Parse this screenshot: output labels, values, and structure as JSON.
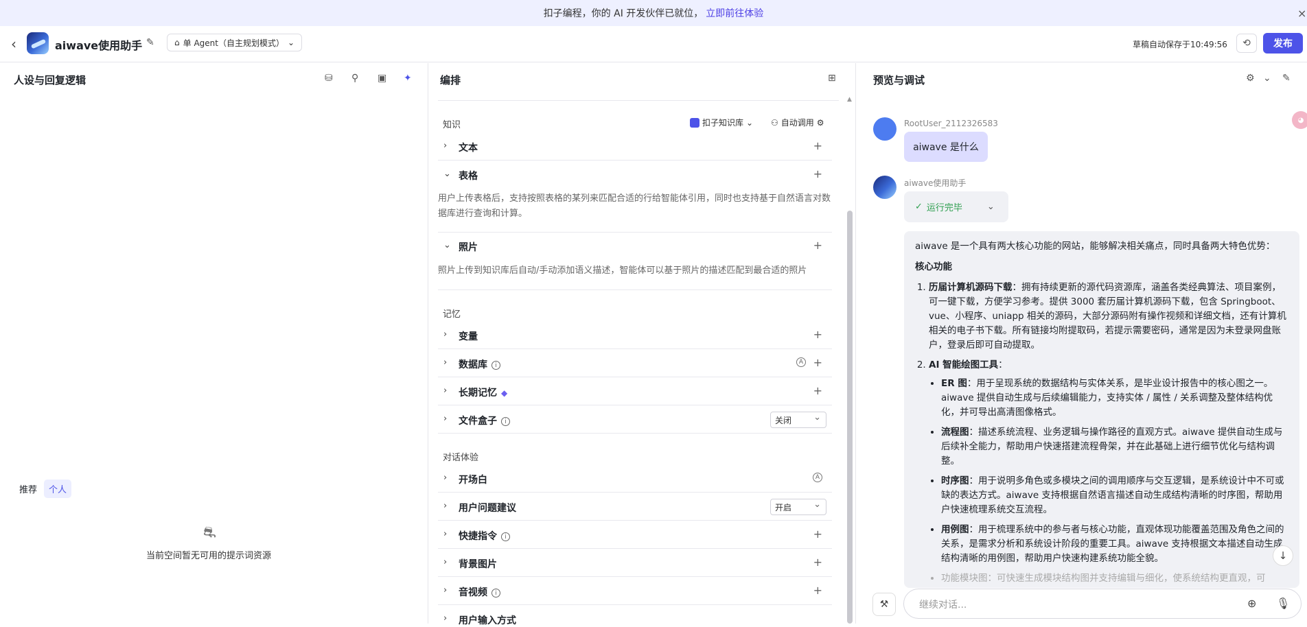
{
  "banner": {
    "text": "扣子编程，你的 AI 开发伙伴已就位，",
    "link": "立即前往体验",
    "close": "×"
  },
  "topbar": {
    "back": "‹",
    "app_name": "aiwave使用助手",
    "edit": "✎",
    "agent_mode": "单 Agent（自主规划模式）",
    "agent_icon": "⌂",
    "chevron": "⌄",
    "saved": "草稿自动保存于10:49:56",
    "history_icon": "⟲",
    "publish": "发布"
  },
  "left": {
    "title": "人设与回复逻辑",
    "icons": [
      "⛁",
      "⚲",
      "▣",
      "✦"
    ],
    "tabs": [
      "推荐",
      "个人"
    ],
    "empty_icon": "⛐",
    "empty_text": "当前空间暂无可用的提示词资源"
  },
  "mid": {
    "title": "编排",
    "grid_icon": "⊞",
    "knowledge": {
      "label": "知识",
      "kb_btn": "扣子知识库",
      "auto_btn": "自动调用"
    },
    "rows": [
      {
        "label": "文本",
        "chev": "›"
      },
      {
        "label": "表格",
        "chev": "⌄"
      },
      {
        "label": "照片",
        "chev": "⌄"
      }
    ],
    "table_desc": "用户上传表格后，支持按照表格的某列来匹配合适的行给智能体引用，同时也支持基于自然语言对数据库进行查询和计算。",
    "photo_desc": "照片上传到知识库后自动/手动添加语义描述，智能体可以基于照片的描述匹配到最合适的照片",
    "memory": {
      "label": "记忆",
      "rows": [
        "变量",
        "数据库",
        "长期记忆",
        "文件盒子"
      ],
      "file_box_value": "关闭"
    },
    "dialog": {
      "label": "对话体验",
      "rows": [
        "开场白",
        "用户问题建议",
        "快捷指令",
        "背景图片",
        "音视频",
        "用户输入方式"
      ],
      "suggest_value": "开启"
    },
    "plus": "+",
    "info": "i",
    "auto": "A"
  },
  "right": {
    "title": "预览与调试",
    "user": {
      "name": "RootUser_2112326583",
      "message": "aiwave 是什么"
    },
    "bot": {
      "name": "aiwave使用助手",
      "status": "运行完毕",
      "intro": "aiwave 是一个具有两大核心功能的网站，能够解决相关痛点，同时具备两大特色优势：",
      "core_title": "核心功能",
      "item1_title": "历届计算机源码下载",
      "item1_text": "：拥有持续更新的源代码资源库，涵盖各类经典算法、项目案例，可一键下载，方便学习参考。提供 3000 套历届计算机源码下载，包含 Springboot、vue、小程序、uniapp 相关的源码，大部分源码附有操作视频和详细文档，还有计算机相关的电子书下载。所有链接均附提取码，若提示需要密码，通常是因为未登录网盘账户，登录后即可自动提取。",
      "item2_title": "AI 智能绘图工具",
      "item2_suffix": "：",
      "subs": [
        {
          "t": "ER 图",
          "d": "：用于呈现系统的数据结构与实体关系，是毕业设计报告中的核心图之一。aiwave 提供自动生成与后续编辑能力，支持实体 / 属性 / 关系调整及整体结构优化，并可导出高清图像格式。"
        },
        {
          "t": "流程图",
          "d": "：描述系统流程、业务逻辑与操作路径的直观方式。aiwave 提供自动生成与后续补全能力，帮助用户快速搭建流程骨架，并在此基础上进行细节优化与结构调整。"
        },
        {
          "t": "时序图",
          "d": "：用于说明多角色或多模块之间的调用顺序与交互逻辑，是系统设计中不可或缺的表达方式。aiwave 支持根据自然语言描述自动生成结构清晰的时序图，帮助用户快速梳理系统交互流程。"
        },
        {
          "t": "用例图",
          "d": "：用于梳理系统中的参与者与核心功能，直观体现功能覆盖范围及角色之间的关系，是需求分析和系统设计阶段的重要工具。aiwave 支持根据文本描述自动生成结构清晰的用例图，帮助用户快速构建系统功能全貌。"
        }
      ],
      "faded": "功能模块图：可快速生成模块结构图并支持编辑与细化，使系统结构更直观，可"
    },
    "input_placeholder": "继续对话...",
    "icons": {
      "bag": "⚒",
      "add": "⊕",
      "mic": "🎙",
      "down": "↓",
      "debug": "⚙",
      "tool": "✎"
    }
  }
}
